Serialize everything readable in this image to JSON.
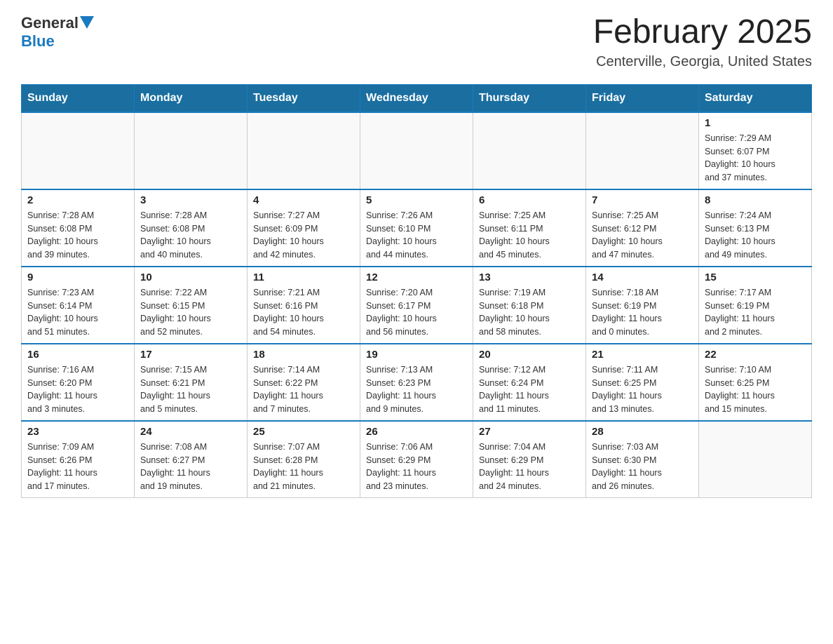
{
  "header": {
    "logo_general": "General",
    "logo_blue": "Blue",
    "month_title": "February 2025",
    "location": "Centerville, Georgia, United States"
  },
  "days_of_week": [
    "Sunday",
    "Monday",
    "Tuesday",
    "Wednesday",
    "Thursday",
    "Friday",
    "Saturday"
  ],
  "weeks": [
    [
      {
        "day": "",
        "info": ""
      },
      {
        "day": "",
        "info": ""
      },
      {
        "day": "",
        "info": ""
      },
      {
        "day": "",
        "info": ""
      },
      {
        "day": "",
        "info": ""
      },
      {
        "day": "",
        "info": ""
      },
      {
        "day": "1",
        "info": "Sunrise: 7:29 AM\nSunset: 6:07 PM\nDaylight: 10 hours\nand 37 minutes."
      }
    ],
    [
      {
        "day": "2",
        "info": "Sunrise: 7:28 AM\nSunset: 6:08 PM\nDaylight: 10 hours\nand 39 minutes."
      },
      {
        "day": "3",
        "info": "Sunrise: 7:28 AM\nSunset: 6:08 PM\nDaylight: 10 hours\nand 40 minutes."
      },
      {
        "day": "4",
        "info": "Sunrise: 7:27 AM\nSunset: 6:09 PM\nDaylight: 10 hours\nand 42 minutes."
      },
      {
        "day": "5",
        "info": "Sunrise: 7:26 AM\nSunset: 6:10 PM\nDaylight: 10 hours\nand 44 minutes."
      },
      {
        "day": "6",
        "info": "Sunrise: 7:25 AM\nSunset: 6:11 PM\nDaylight: 10 hours\nand 45 minutes."
      },
      {
        "day": "7",
        "info": "Sunrise: 7:25 AM\nSunset: 6:12 PM\nDaylight: 10 hours\nand 47 minutes."
      },
      {
        "day": "8",
        "info": "Sunrise: 7:24 AM\nSunset: 6:13 PM\nDaylight: 10 hours\nand 49 minutes."
      }
    ],
    [
      {
        "day": "9",
        "info": "Sunrise: 7:23 AM\nSunset: 6:14 PM\nDaylight: 10 hours\nand 51 minutes."
      },
      {
        "day": "10",
        "info": "Sunrise: 7:22 AM\nSunset: 6:15 PM\nDaylight: 10 hours\nand 52 minutes."
      },
      {
        "day": "11",
        "info": "Sunrise: 7:21 AM\nSunset: 6:16 PM\nDaylight: 10 hours\nand 54 minutes."
      },
      {
        "day": "12",
        "info": "Sunrise: 7:20 AM\nSunset: 6:17 PM\nDaylight: 10 hours\nand 56 minutes."
      },
      {
        "day": "13",
        "info": "Sunrise: 7:19 AM\nSunset: 6:18 PM\nDaylight: 10 hours\nand 58 minutes."
      },
      {
        "day": "14",
        "info": "Sunrise: 7:18 AM\nSunset: 6:19 PM\nDaylight: 11 hours\nand 0 minutes."
      },
      {
        "day": "15",
        "info": "Sunrise: 7:17 AM\nSunset: 6:19 PM\nDaylight: 11 hours\nand 2 minutes."
      }
    ],
    [
      {
        "day": "16",
        "info": "Sunrise: 7:16 AM\nSunset: 6:20 PM\nDaylight: 11 hours\nand 3 minutes."
      },
      {
        "day": "17",
        "info": "Sunrise: 7:15 AM\nSunset: 6:21 PM\nDaylight: 11 hours\nand 5 minutes."
      },
      {
        "day": "18",
        "info": "Sunrise: 7:14 AM\nSunset: 6:22 PM\nDaylight: 11 hours\nand 7 minutes."
      },
      {
        "day": "19",
        "info": "Sunrise: 7:13 AM\nSunset: 6:23 PM\nDaylight: 11 hours\nand 9 minutes."
      },
      {
        "day": "20",
        "info": "Sunrise: 7:12 AM\nSunset: 6:24 PM\nDaylight: 11 hours\nand 11 minutes."
      },
      {
        "day": "21",
        "info": "Sunrise: 7:11 AM\nSunset: 6:25 PM\nDaylight: 11 hours\nand 13 minutes."
      },
      {
        "day": "22",
        "info": "Sunrise: 7:10 AM\nSunset: 6:25 PM\nDaylight: 11 hours\nand 15 minutes."
      }
    ],
    [
      {
        "day": "23",
        "info": "Sunrise: 7:09 AM\nSunset: 6:26 PM\nDaylight: 11 hours\nand 17 minutes."
      },
      {
        "day": "24",
        "info": "Sunrise: 7:08 AM\nSunset: 6:27 PM\nDaylight: 11 hours\nand 19 minutes."
      },
      {
        "day": "25",
        "info": "Sunrise: 7:07 AM\nSunset: 6:28 PM\nDaylight: 11 hours\nand 21 minutes."
      },
      {
        "day": "26",
        "info": "Sunrise: 7:06 AM\nSunset: 6:29 PM\nDaylight: 11 hours\nand 23 minutes."
      },
      {
        "day": "27",
        "info": "Sunrise: 7:04 AM\nSunset: 6:29 PM\nDaylight: 11 hours\nand 24 minutes."
      },
      {
        "day": "28",
        "info": "Sunrise: 7:03 AM\nSunset: 6:30 PM\nDaylight: 11 hours\nand 26 minutes."
      },
      {
        "day": "",
        "info": ""
      }
    ]
  ]
}
